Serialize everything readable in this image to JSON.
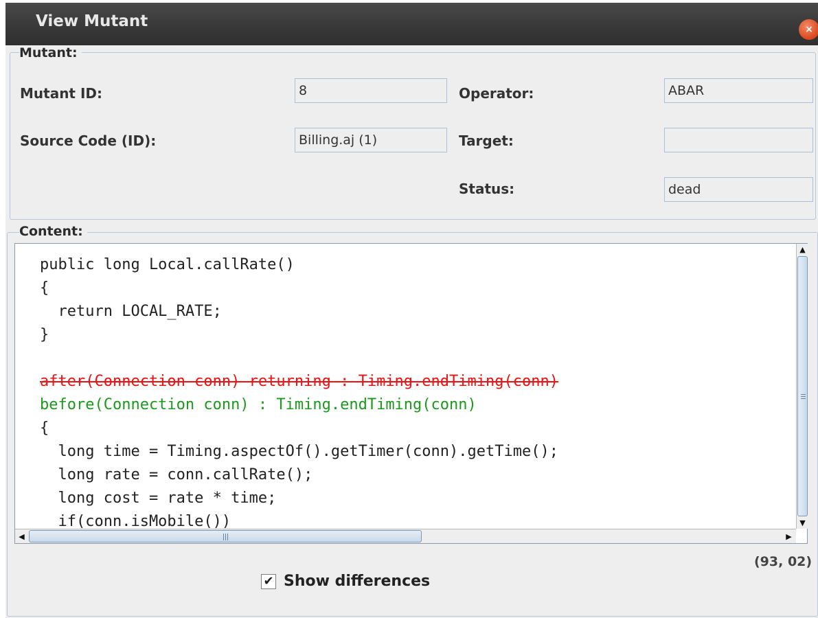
{
  "window": {
    "title": "View Mutant",
    "close_glyph": "×"
  },
  "mutant_group": {
    "legend": "Mutant:",
    "mutant_id_label": "Mutant ID:",
    "mutant_id_value": "8",
    "operator_label": "Operator:",
    "operator_value": "ABAR",
    "source_label": "Source Code (ID):",
    "source_value": "Billing.aj (1)",
    "target_label": "Target:",
    "target_value": "",
    "status_label": "Status:",
    "status_value": "dead"
  },
  "content_group": {
    "legend": "Content:",
    "code_lines": [
      "public long Local.callRate()",
      "{",
      "  return LOCAL_RATE;",
      "}",
      "",
      "after(Connection conn) returning : Timing.endTiming(conn)",
      "before(Connection conn) : Timing.endTiming(conn)",
      "{",
      "  long time = Timing.aspectOf().getTimer(conn).getTime();",
      "  long rate = conn.callRate();",
      "  long cost = rate * time;",
      "  if(conn.isMobile())"
    ],
    "removed_line_index": 5,
    "added_line_index": 6,
    "cursor_position": "(93, 02)"
  },
  "show_differences": {
    "label": "Show differences",
    "checked": true,
    "check_glyph": "✔"
  },
  "icons": {
    "close": "close-icon",
    "scroll_up": "▲",
    "scroll_down": "▼",
    "scroll_left": "◀",
    "scroll_right": "▶"
  },
  "colors": {
    "removed": "#ee1111",
    "added": "#1a9a1a",
    "close_button": "#d9461d"
  }
}
